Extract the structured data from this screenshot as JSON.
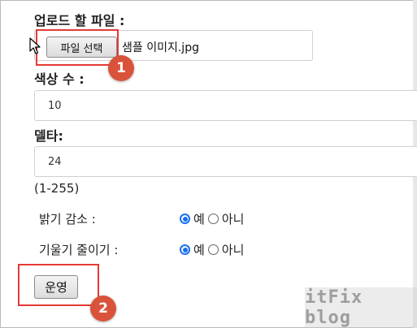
{
  "form": {
    "upload_label": "업로드 할 파일 :",
    "file_button_label": "파일 선택",
    "file_name": "샘플 이미지.jpg",
    "colors_label": "색상 수 :",
    "colors_value": "10",
    "delta_label": "델타:",
    "delta_value": "24",
    "delta_range": "(1-255)",
    "reduce_brightness_label": "밝기 감소 :",
    "reduce_brightness_yes": "예",
    "reduce_brightness_no": "아니",
    "reduce_brightness_selected": "예",
    "reduce_gradient_label": "기울기 줄이기 :",
    "reduce_gradient_yes": "예",
    "reduce_gradient_no": "아니",
    "reduce_gradient_selected": "예",
    "run_button_label": "운영"
  },
  "annotations": {
    "badge_1": "1",
    "badge_2": "2",
    "highlight_color": "#e53935",
    "badge_color": "#d9533a"
  },
  "watermark": "itFix blog",
  "colors": {
    "radio_selected": "#1a6ff0"
  }
}
